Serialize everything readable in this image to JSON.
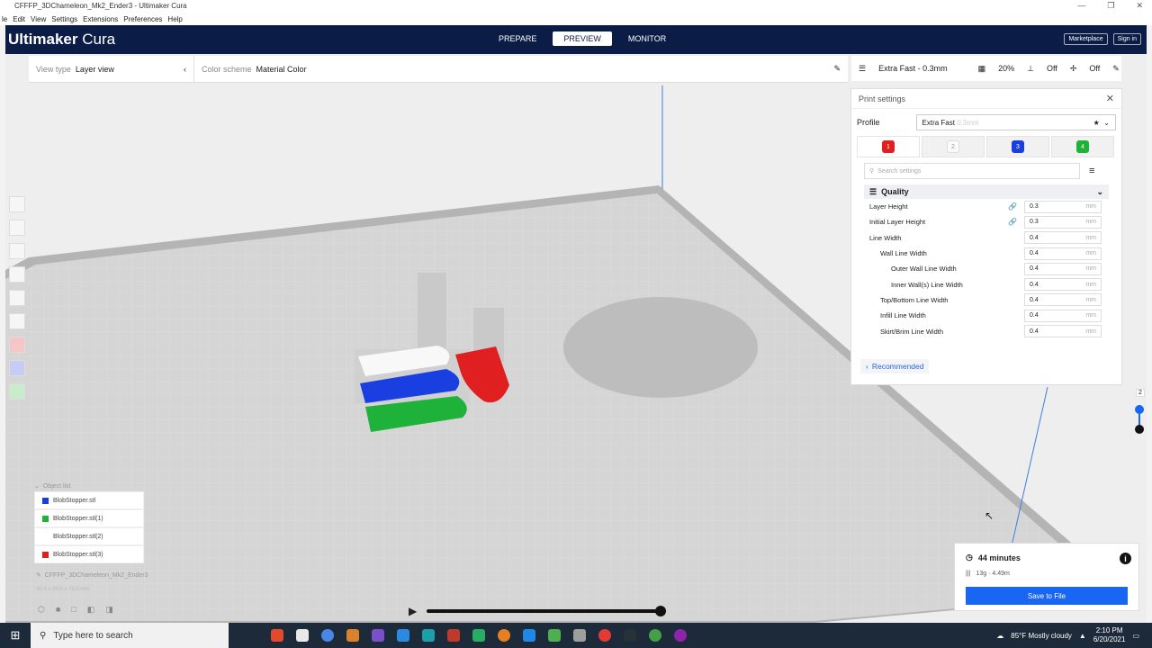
{
  "window": {
    "title": "CFFFP_3DChameleon_Mk2_Ender3 - Ultimaker Cura",
    "controls": [
      "—",
      "❐",
      "✕"
    ]
  },
  "menu": [
    "le",
    "Edit",
    "View",
    "Settings",
    "Extensions",
    "Preferences",
    "Help"
  ],
  "header": {
    "brand_bold": "Ultimaker",
    "brand_light": " Cura",
    "stages": [
      "PREPARE",
      "PREVIEW",
      "MONITOR"
    ],
    "active_stage": "PREVIEW",
    "marketplace": "Marketplace",
    "signin": "Sign in"
  },
  "viewbar": {
    "view_type_label": "View type",
    "view_type_value": "Layer view",
    "color_scheme_label": "Color scheme",
    "color_scheme_value": "Material Color"
  },
  "printbar": {
    "profile": "Extra Fast - 0.3mm",
    "infill": "20%",
    "support": "Off",
    "adhesion": "Off"
  },
  "print_settings": {
    "title": "Print settings",
    "profile_label": "Profile",
    "profile_value": "Extra Fast",
    "profile_hint": "0.3mm",
    "extruders": [
      {
        "label": "1",
        "color": "#e02020"
      },
      {
        "label": "2",
        "color": "#dddddd"
      },
      {
        "label": "3",
        "color": "#1a3fe0"
      },
      {
        "label": "4",
        "color": "#1fb23a"
      }
    ],
    "search_placeholder": "Search settings",
    "category": "Quality",
    "rows": [
      {
        "name": "Layer Height",
        "value": "0.3",
        "unit": "mm",
        "indent": 0,
        "link": true
      },
      {
        "name": "Initial Layer Height",
        "value": "0.3",
        "unit": "mm",
        "indent": 0,
        "link": true
      },
      {
        "name": "Line Width",
        "value": "0.4",
        "unit": "mm",
        "indent": 0,
        "link": false
      },
      {
        "name": "Wall Line Width",
        "value": "0.4",
        "unit": "mm",
        "indent": 1,
        "link": false
      },
      {
        "name": "Outer Wall Line Width",
        "value": "0.4",
        "unit": "mm",
        "indent": 2,
        "link": false
      },
      {
        "name": "Inner Wall(s) Line Width",
        "value": "0.4",
        "unit": "mm",
        "indent": 2,
        "link": false
      },
      {
        "name": "Top/Bottom Line Width",
        "value": "0.4",
        "unit": "mm",
        "indent": 1,
        "link": false
      },
      {
        "name": "Infill Line Width",
        "value": "0.4",
        "unit": "mm",
        "indent": 1,
        "link": false
      },
      {
        "name": "Skirt/Brim Line Width",
        "value": "0.4",
        "unit": "mm",
        "indent": 1,
        "link": false
      }
    ],
    "recommended": "Recommended"
  },
  "object_list": {
    "title": "Object list",
    "items": [
      {
        "name": "BlobStopper.stl",
        "color": "#1a3fe0"
      },
      {
        "name": "BlobStopper.stl(1)",
        "color": "#1fb23a"
      },
      {
        "name": "BlobStopper.stl(2)",
        "color": "#ffffff"
      },
      {
        "name": "BlobStopper.stl(3)",
        "color": "#e02020"
      }
    ],
    "project_name": "CFFFP_3DChameleon_Mk2_Ender3",
    "dimensions": "40.0 x 38.0 x 25.0 mm"
  },
  "estimate": {
    "time": "44 minutes",
    "material": "13g · 4.49m",
    "save_label": "Save to File"
  },
  "layer_slider": {
    "top_label": "2"
  },
  "taskbar": {
    "search_placeholder": "Type here to search",
    "weather": "85°F  Mostly cloudy",
    "time": "2:10 PM",
    "date": "6/20/2021"
  }
}
